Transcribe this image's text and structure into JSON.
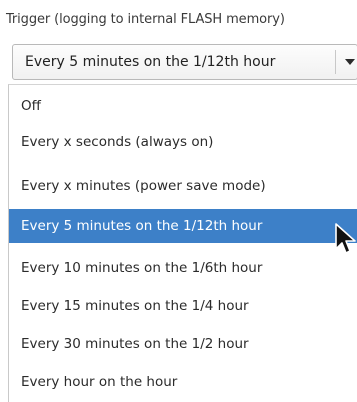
{
  "trigger_group": {
    "label": "Trigger (logging to internal FLASH memory)"
  },
  "combo": {
    "value": "Every 5 minutes on the 1/12th hour",
    "arrow_icon": "triangle-down-icon"
  },
  "options": [
    "Off",
    "Every x seconds (always on)",
    "Every x minutes (power save mode)",
    "Every 5 minutes on the 1/12th hour",
    "Every 10 minutes on the 1/6th hour",
    "Every 15 minutes on the 1/4 hour",
    "Every  30 minutes on the 1/2 hour",
    "Every hour on the hour"
  ],
  "selected_index": 3,
  "colors": {
    "selection": "#3d80c8",
    "selection_text": "#ffffff"
  },
  "cursor_icon": "mouse-pointer-icon"
}
